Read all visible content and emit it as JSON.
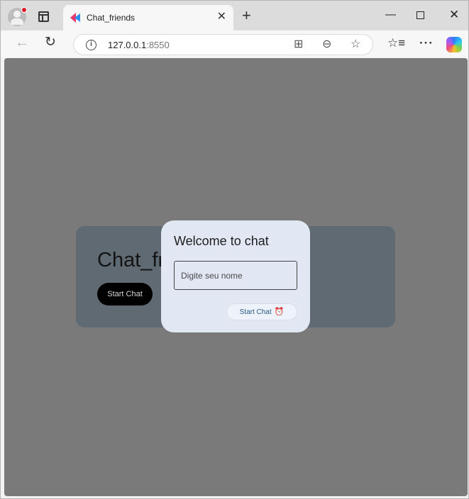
{
  "browser": {
    "tab_title": "Chat_friends",
    "tab_close": "✕",
    "new_tab": "+",
    "url_host": "127.0.0.1",
    "url_port": ":8550",
    "window_minimize": "—",
    "window_close": "✕"
  },
  "page": {
    "heading": "Chat_friends",
    "start_button": "Start Chat"
  },
  "dialog": {
    "title": "Welcome to chat",
    "name_placeholder": "Digite seu nome",
    "name_value": "",
    "submit_label": "Start Chat"
  },
  "colors": {
    "overlay": "#7a7a7a",
    "dialog_bg": "#e1e7f3",
    "card_bg": "#5f6a72",
    "button_text": "#2a5a86"
  }
}
